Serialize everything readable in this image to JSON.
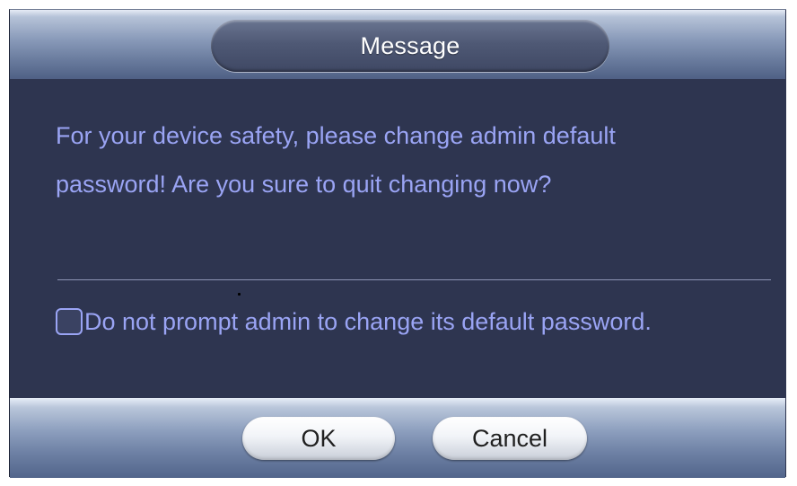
{
  "dialog": {
    "title": "Message",
    "message": "For your device safety, please change admin default\npassword! Are you sure to quit changing now?",
    "checkbox": {
      "label": "Do not prompt admin to change its default password.",
      "checked": false
    },
    "buttons": {
      "ok_label": "OK",
      "cancel_label": "Cancel"
    }
  },
  "colors": {
    "body_background": "#2e3550",
    "message_text": "#9aa4f4",
    "divider": "#8d94b4"
  }
}
